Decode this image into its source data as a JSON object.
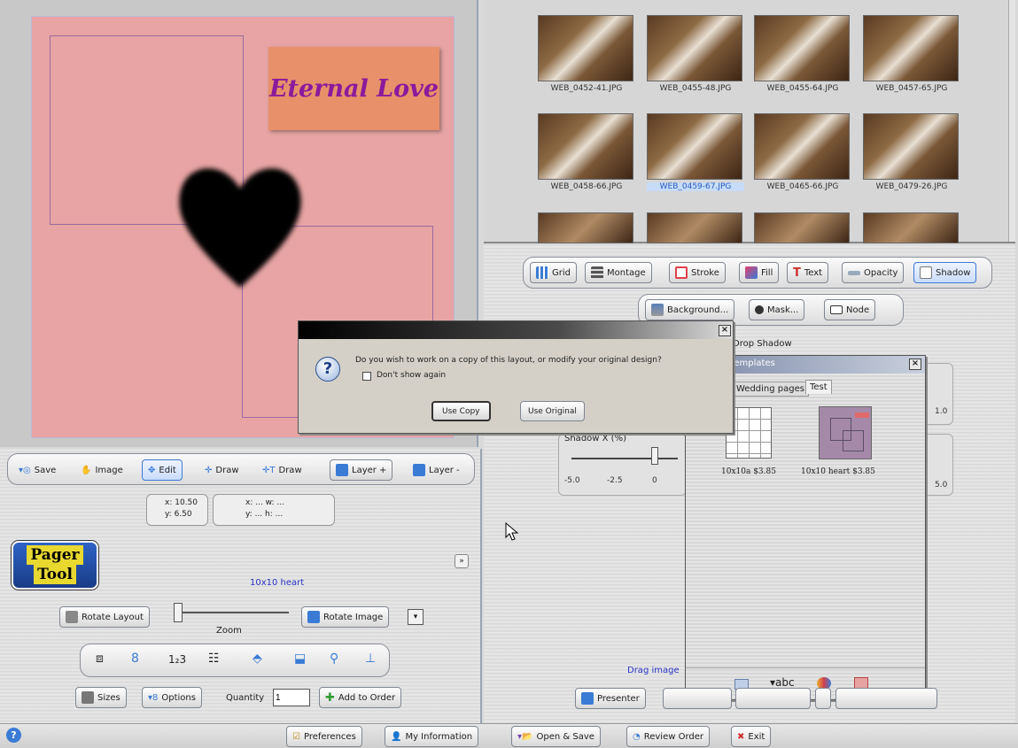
{
  "canvas": {
    "title_text": "Eternal Love",
    "bg_color": "#e8a4a4",
    "title_bg": "#e8906a",
    "title_color": "#8b1a9c"
  },
  "thumbnails": [
    {
      "name": "WEB_0452-41.JPG",
      "selected": false
    },
    {
      "name": "WEB_0455-48.JPG",
      "selected": false
    },
    {
      "name": "WEB_0455-64.JPG",
      "selected": false
    },
    {
      "name": "WEB_0457-65.JPG",
      "selected": false
    },
    {
      "name": "WEB_0458-66.JPG",
      "selected": false
    },
    {
      "name": "WEB_0459-67.JPG",
      "selected": true
    },
    {
      "name": "WEB_0465-66.JPG",
      "selected": false
    },
    {
      "name": "WEB_0479-26.JPG",
      "selected": false
    }
  ],
  "right_toolbar": {
    "grid": "Grid",
    "montage": "Montage",
    "stroke": "Stroke",
    "fill": "Fill",
    "text": "Text",
    "opacity": "Opacity",
    "shadow": "Shadow",
    "background": "Background...",
    "mask": "Mask...",
    "node": "Node"
  },
  "shadow_panel": {
    "title": "Drop Shadow",
    "slider_label": "Shadow X (%)",
    "ticks": [
      "-5.0",
      "-2.5",
      "0"
    ],
    "right_ticks_1": "1.0",
    "right_ticks_2": "5.0"
  },
  "templates": {
    "title": "Templates",
    "tabs": [
      "Wedding pages",
      "Test"
    ],
    "items": [
      {
        "label": "10x10a $3.85"
      },
      {
        "label": "10x10 heart $3.85"
      }
    ],
    "footer_text": "abc"
  },
  "dialog": {
    "message": "Do you wish to work on a copy of this layout, or modify your original design?",
    "checkbox": "Don't show again",
    "use_copy": "Use Copy",
    "use_original": "Use Original"
  },
  "left_toolbar": {
    "save": "Save",
    "image": "Image",
    "edit": "Edit",
    "draw": "Draw",
    "tdraw": "Draw",
    "layer_add": "Layer +",
    "layer_remove": "Layer -",
    "coord_x": "x: 10.50",
    "coord_y": "y: 6.50",
    "dim_x": "x: ... w: ...",
    "dim_y": "y: ... h: ..."
  },
  "pager": {
    "logo_line1": "Pager",
    "logo_line2": "Tool",
    "layout_name": "10x10 heart",
    "rotate_layout": "Rotate Layout",
    "zoom": "Zoom",
    "rotate_image": "Rotate Image",
    "sizes": "Sizes",
    "options": "Options",
    "quantity_label": "Quantity",
    "quantity_value": "1",
    "add_to_order": "Add to Order"
  },
  "right_bottom": {
    "drag_hint": "Drag image",
    "presenter": "Presenter"
  },
  "status": {
    "preferences": "Preferences",
    "my_information": "My Information",
    "open_save": "Open & Save",
    "review_order": "Review Order",
    "exit": "Exit"
  }
}
